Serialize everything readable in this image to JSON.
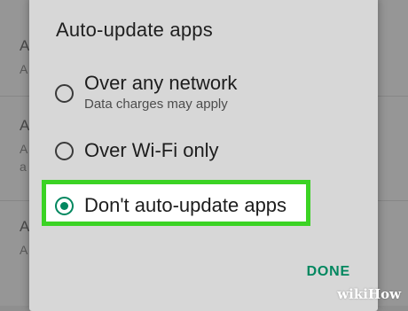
{
  "background": {
    "lines": [
      {
        "text": "A",
        "size": "big"
      },
      {
        "text": "A",
        "size": "small"
      },
      {
        "text": "A",
        "size": "big"
      },
      {
        "text": "A",
        "size": "small"
      },
      {
        "text": "a",
        "size": "small"
      },
      {
        "text": "A",
        "size": "big"
      },
      {
        "text": "A",
        "size": "small"
      }
    ]
  },
  "dialog": {
    "title": "Auto-update apps",
    "options": [
      {
        "label": "Over any network",
        "sublabel": "Data charges may apply",
        "selected": false
      },
      {
        "label": "Over Wi-Fi only",
        "sublabel": "",
        "selected": false
      },
      {
        "label": "Don't auto-update apps",
        "sublabel": "",
        "selected": true
      }
    ],
    "done_label": "DONE"
  },
  "colors": {
    "accent": "#01875f",
    "highlight": "#3bd324",
    "dialog_bg": "#d7d7d7"
  },
  "watermark": {
    "text": "wikiHow"
  }
}
